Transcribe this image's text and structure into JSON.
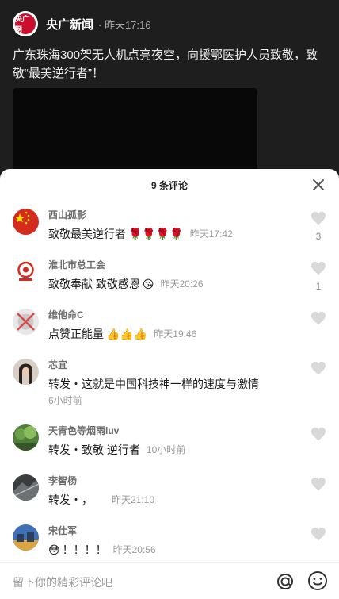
{
  "post": {
    "logo_text": "央广网",
    "author": "央广新闻",
    "time": "· 昨天17:16",
    "text": "广东珠海300架无人机点亮夜空，向援鄂医护人员致敬，致敬“最美逆行者”！"
  },
  "sheet": {
    "title": "9 条评论"
  },
  "comments": [
    {
      "name": "西山孤影",
      "text": "致敬最美逆行者",
      "emoji": "🌹🌹🌹🌹",
      "time": "昨天17:42",
      "likes": "3"
    },
    {
      "name": "淮北市总工会",
      "text": "致敬奉献 致敬感恩",
      "emoji": "😘",
      "time": "昨天20:26",
      "likes": "1"
    },
    {
      "name": "维他命C",
      "text": "点赞正能量",
      "emoji": "👍👍👍",
      "time": "昨天19:46",
      "likes": ""
    },
    {
      "name": "芯宜",
      "text": "转发・这就是中国科技神一样的速度与激情",
      "emoji": "",
      "time": "6小时前",
      "likes": ""
    },
    {
      "name": "天青色等烟雨luv",
      "text": "转发・致敬 逆行者",
      "emoji": "",
      "time": "10小时前",
      "likes": ""
    },
    {
      "name": "李智杨",
      "text": "转发・，",
      "emoji": "",
      "time": "昨天21:10",
      "likes": ""
    },
    {
      "name": "宋仕军",
      "text": "！！！！",
      "emoji": "😳",
      "time": "昨天20:56",
      "likes": ""
    }
  ],
  "input": {
    "placeholder": "留下你的精彩评论吧"
  },
  "icons": {
    "close": "close-icon",
    "like": "heart-icon",
    "at": "at-icon",
    "emoji": "smiley-icon"
  },
  "colors": {
    "heart": "#d9d9d9",
    "logo_red": "#c8102e"
  }
}
